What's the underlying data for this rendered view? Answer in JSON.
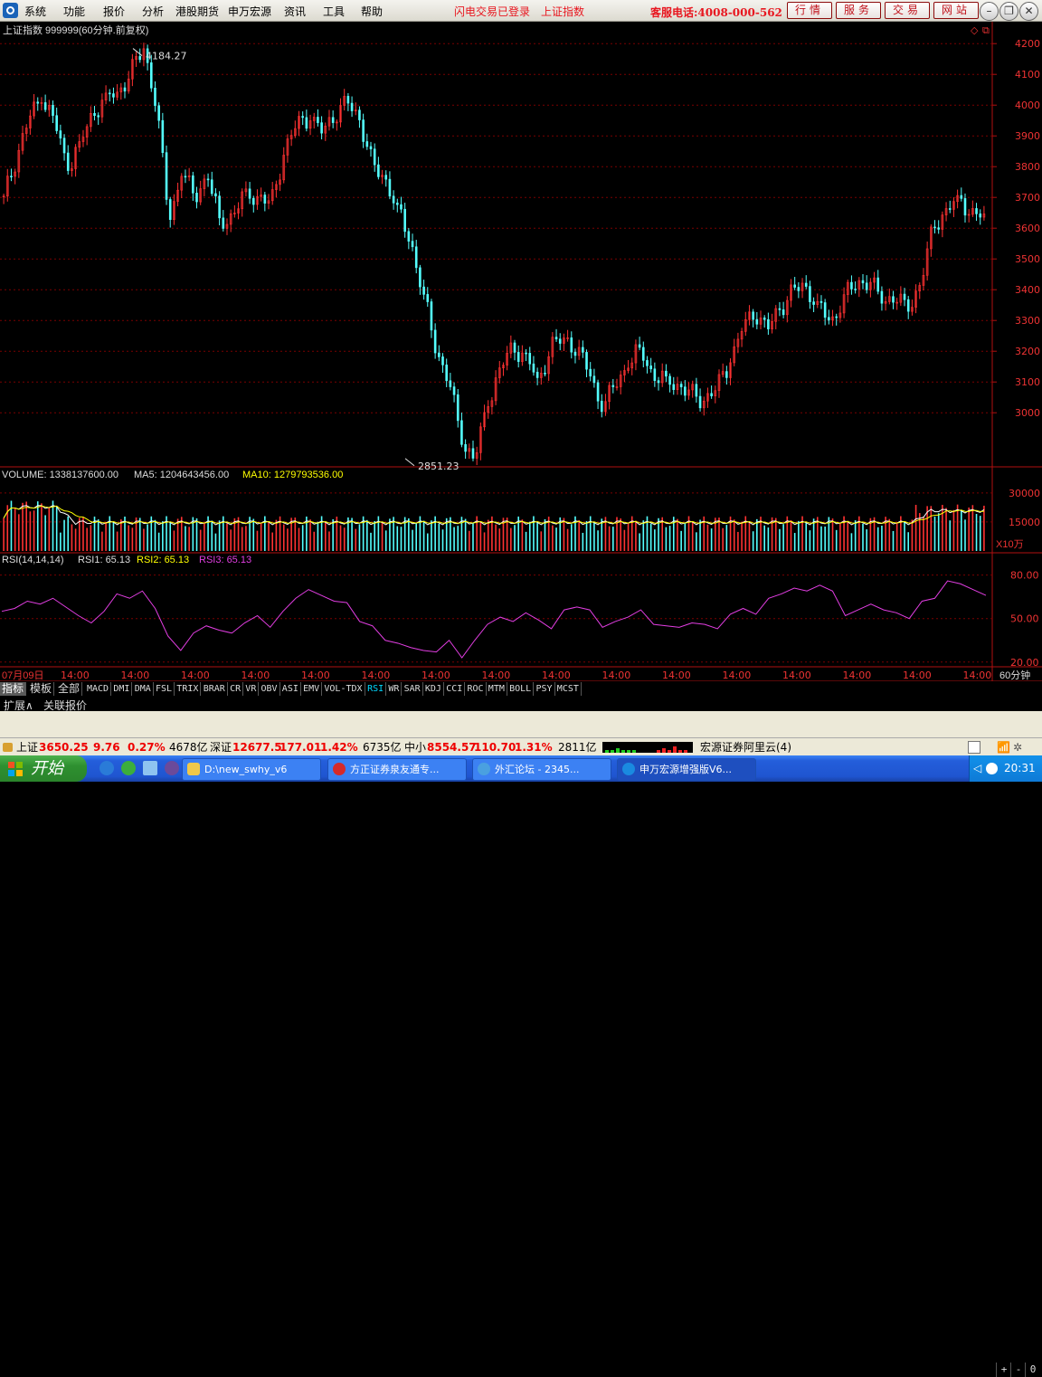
{
  "menu": {
    "items": [
      "系统",
      "功能",
      "报价",
      "分析",
      "港股期货",
      "申万宏源",
      "资讯",
      "工具",
      "帮助"
    ],
    "status_login": "闪电交易已登录",
    "status_index": "上证指数",
    "hotline": "客服电话:4008-000-562",
    "buttons": [
      "行情",
      "服务",
      "交易",
      "网站"
    ]
  },
  "chart_header": {
    "title": "上证指数 999999(60分钟.前复权)",
    "high_label": "4184.27",
    "low_label": "2851.23"
  },
  "volume_header": {
    "volume": "VOLUME: 1338137600.00",
    "ma5": "MA5: 1204643456.00",
    "ma10": "MA10: 1279793536.00",
    "unit": "X10万"
  },
  "rsi_header": {
    "rsi_name": "RSI(14,14,14)",
    "rsi1": "RSI1: 65.13",
    "rsi2": "RSI2: 65.13",
    "rsi3": "RSI3: 65.13"
  },
  "x_axis": {
    "first": "07月09日",
    "labels": [
      "14:00",
      "14:00",
      "14:00",
      "14:00",
      "14:00",
      "14:00",
      "14:00",
      "14:00",
      "14:00",
      "14:00",
      "14:00",
      "14:00",
      "14:00",
      "14:00",
      "14:00",
      "14:00"
    ],
    "period": "60分钟"
  },
  "indicator_tabs": {
    "cn": [
      "指标",
      "模板",
      "全部"
    ],
    "en": [
      "MACD",
      "DMI",
      "DMA",
      "FSL",
      "TRIX",
      "BRAR",
      "CR",
      "VR",
      "OBV",
      "ASI",
      "EMV",
      "VOL-TDX",
      "RSI",
      "WR",
      "SAR",
      "KDJ",
      "CCI",
      "ROC",
      "MTM",
      "BOLL",
      "PSY",
      "MCST"
    ],
    "active": "RSI",
    "pager": [
      "+",
      "-",
      "0"
    ]
  },
  "sub_tabs": [
    "扩展∧",
    "关联报价"
  ],
  "ticker": {
    "sh_label": "上证",
    "sh_value": "3650.25",
    "sh_change": "9.76",
    "sh_pct": "0.27%",
    "sh_amount": "4678亿",
    "sz_label": "深证",
    "sz_value": "12677.5",
    "sz_change": "177.01",
    "sz_pct": "1.42%",
    "sz_amount": "6735亿",
    "zx_label": "中小",
    "zx_value": "8554.57",
    "zx_change": "110.70",
    "zx_pct": "1.31%",
    "zx_amount": "2811亿",
    "server": "宏源证券阿里云(4)"
  },
  "taskbar": {
    "start": "开始",
    "tasks": [
      "D:\\new_swhy_v6",
      "方正证券泉友通专...",
      "外汇论坛 - 2345...",
      "申万宏源增强版V6..."
    ],
    "clock": "20:31"
  },
  "colors": {
    "up": "#ff3232",
    "down": "#54ffff",
    "grid": "#7a0000",
    "rsi": "#e23ee2",
    "ma10": "#ffff00"
  },
  "chart_data": [
    {
      "type": "candlestick",
      "title": "上证指数 999999(60分钟.前复权)",
      "y_ticks": [
        3000,
        3100,
        3200,
        3300,
        3400,
        3500,
        3600,
        3700,
        3800,
        3900,
        4000,
        4100,
        4200
      ],
      "ylim": [
        2830,
        4230
      ],
      "annotations": [
        {
          "label": "4184.27",
          "value": 4184.27
        },
        {
          "label": "2851.23",
          "value": 2851.23
        }
      ],
      "series": [
        {
          "values": [
            3700,
            3830,
            3960,
            4020,
            3950,
            3790,
            3880,
            3970,
            4030,
            4040,
            4110,
            4184.27,
            4000,
            3620,
            3780,
            3700,
            3770,
            3620,
            3640,
            3720,
            3700,
            3680,
            3840,
            3940,
            3960,
            3910,
            3970,
            4010,
            3950,
            3800,
            3760,
            3660,
            3550,
            3380,
            3200,
            3100,
            2900,
            2851.23,
            3020,
            3150,
            3210,
            3190,
            3100,
            3220,
            3240,
            3210,
            3130,
            3010,
            3090,
            3150,
            3210,
            3120,
            3110,
            3090,
            3060,
            3040,
            3080,
            3160,
            3270,
            3330,
            3270,
            3340,
            3400,
            3410,
            3350,
            3290,
            3380,
            3420,
            3430,
            3360,
            3380,
            3330,
            3420,
            3600,
            3660,
            3700,
            3650,
            3640
          ]
        }
      ]
    },
    {
      "type": "bar",
      "title": "VOLUME",
      "y_ticks": [
        15000,
        30000
      ],
      "ylim": [
        0,
        36000
      ],
      "unit": "X10万"
    },
    {
      "type": "line",
      "title": "RSI(14,14,14)",
      "y_ticks": [
        20,
        50,
        80
      ],
      "ylim": [
        18,
        86
      ],
      "series": [
        {
          "name": "RSI1",
          "values": [
            55,
            57,
            62,
            60,
            64,
            58,
            52,
            47,
            55,
            67,
            64,
            69,
            57,
            38,
            28,
            40,
            45,
            42,
            40,
            47,
            52,
            44,
            55,
            64,
            70,
            66,
            62,
            61,
            48,
            45,
            35,
            33,
            30,
            28,
            27,
            35,
            23,
            35,
            46,
            51,
            48,
            54,
            49,
            43,
            56,
            58,
            56,
            44,
            48,
            51,
            56,
            46,
            45,
            44,
            47,
            46,
            43,
            53,
            57,
            53,
            64,
            67,
            71,
            69,
            73,
            69,
            52,
            56,
            60,
            56,
            54,
            50,
            62,
            64,
            76,
            74,
            70,
            66
          ]
        }
      ]
    }
  ]
}
